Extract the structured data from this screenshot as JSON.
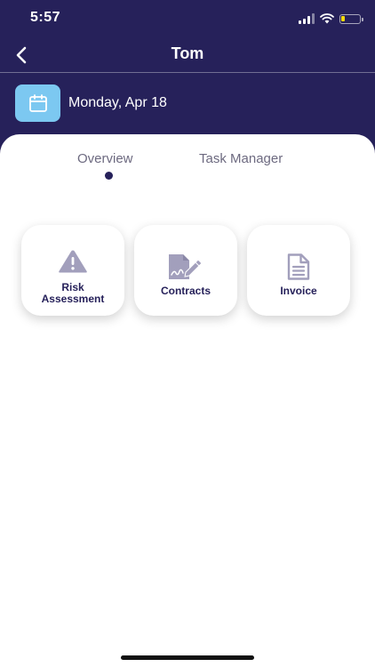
{
  "status_bar": {
    "time": "5:57",
    "battery_level": 0.2,
    "battery_color": "#f5d90a"
  },
  "nav": {
    "back_icon": "chevron-left-icon",
    "title": "Tom"
  },
  "date_row": {
    "icon": "calendar-icon",
    "date": "Monday, Apr 18"
  },
  "tabs": [
    {
      "label": "Overview",
      "selected": true
    },
    {
      "label": "Task Manager",
      "selected": false
    }
  ],
  "cards": [
    {
      "label": "Risk Assessment",
      "icon": "warning-icon"
    },
    {
      "label": "Contracts",
      "icon": "contract-signature-icon"
    },
    {
      "label": "Invoice",
      "icon": "document-icon"
    }
  ],
  "colors": {
    "brand": "#26215a",
    "calendar_tile": "#7cc8f1",
    "card_icon": "#a29fbc"
  }
}
